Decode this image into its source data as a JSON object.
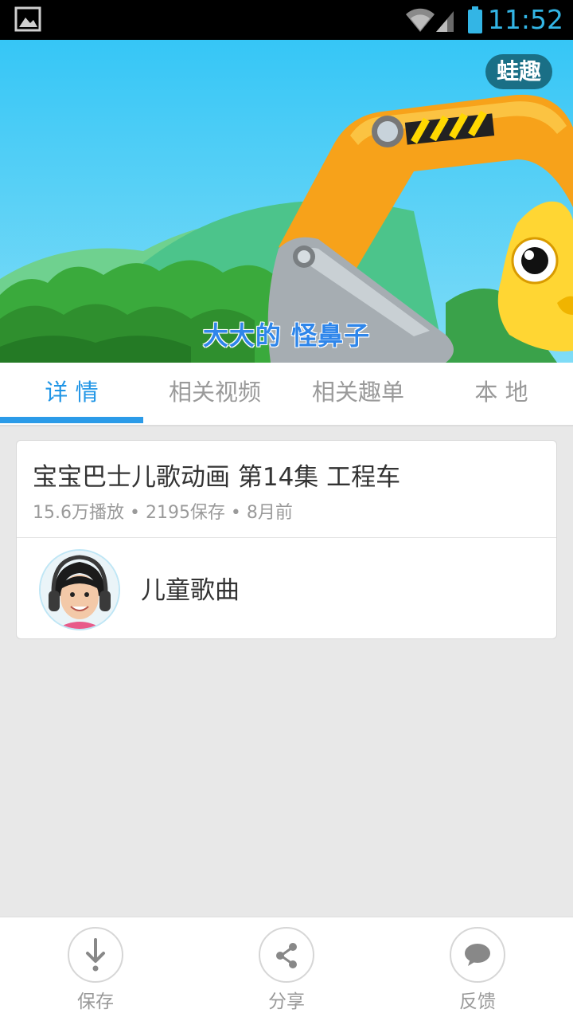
{
  "status_bar": {
    "time": "11:52"
  },
  "video": {
    "brand_badge": "蛙趣",
    "subtitle": "大大的 怪鼻子"
  },
  "tabs": [
    {
      "label": "详 情",
      "active": true
    },
    {
      "label": "相关视频",
      "active": false
    },
    {
      "label": "相关趣单",
      "active": false
    },
    {
      "label": "本 地",
      "active": false
    }
  ],
  "details": {
    "title": "宝宝巴士儿歌动画 第14集 工程车",
    "meta": "15.6万播放 • 2195保存 • 8月前",
    "author": "儿童歌曲"
  },
  "actions": {
    "save": {
      "label": "保存",
      "icon": "download-icon"
    },
    "share": {
      "label": "分享",
      "icon": "share-icon"
    },
    "feedback": {
      "label": "反馈",
      "icon": "comment-icon"
    }
  },
  "colors": {
    "accent": "#2196e6",
    "status_time": "#33b5e5",
    "badge": "#1a6f86"
  }
}
